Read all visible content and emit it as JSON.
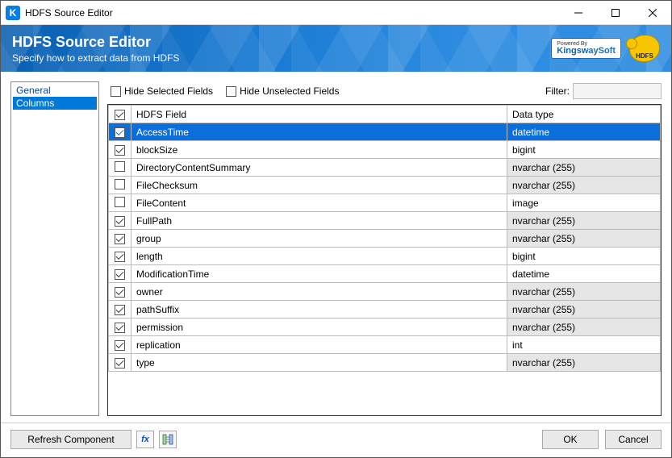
{
  "titlebar": {
    "title": "HDFS Source Editor"
  },
  "banner": {
    "heading": "HDFS Source Editor",
    "subtitle": "Specify how to extract data from HDFS",
    "ksw_powered": "Powered By",
    "ksw_name": "KingswaySoft",
    "hdfs_label": "HDFS"
  },
  "sidebar": {
    "items": [
      {
        "label": "General",
        "selected": false
      },
      {
        "label": "Columns",
        "selected": true
      }
    ]
  },
  "toolbar": {
    "hide_selected": "Hide Selected Fields",
    "hide_unselected": "Hide Unselected Fields",
    "filter_label": "Filter:",
    "filter_value": ""
  },
  "grid": {
    "headers": {
      "field": "HDFS Field",
      "type": "Data type"
    },
    "rows": [
      {
        "checked": true,
        "selected": true,
        "field": "AccessTime",
        "type": "datetime",
        "typeDisabled": false
      },
      {
        "checked": true,
        "selected": false,
        "field": "blockSize",
        "type": "bigint",
        "typeDisabled": false
      },
      {
        "checked": false,
        "selected": false,
        "field": "DirectoryContentSummary",
        "type": "nvarchar (255)",
        "typeDisabled": true
      },
      {
        "checked": false,
        "selected": false,
        "field": "FileChecksum",
        "type": "nvarchar (255)",
        "typeDisabled": true
      },
      {
        "checked": false,
        "selected": false,
        "field": "FileContent",
        "type": "image",
        "typeDisabled": false
      },
      {
        "checked": true,
        "selected": false,
        "field": "FullPath",
        "type": "nvarchar (255)",
        "typeDisabled": true
      },
      {
        "checked": true,
        "selected": false,
        "field": "group",
        "type": "nvarchar (255)",
        "typeDisabled": true
      },
      {
        "checked": true,
        "selected": false,
        "field": "length",
        "type": "bigint",
        "typeDisabled": false
      },
      {
        "checked": true,
        "selected": false,
        "field": "ModificationTime",
        "type": "datetime",
        "typeDisabled": false
      },
      {
        "checked": true,
        "selected": false,
        "field": "owner",
        "type": "nvarchar (255)",
        "typeDisabled": true
      },
      {
        "checked": true,
        "selected": false,
        "field": "pathSuffix",
        "type": "nvarchar (255)",
        "typeDisabled": true
      },
      {
        "checked": true,
        "selected": false,
        "field": "permission",
        "type": "nvarchar (255)",
        "typeDisabled": true
      },
      {
        "checked": true,
        "selected": false,
        "field": "replication",
        "type": "int",
        "typeDisabled": false
      },
      {
        "checked": true,
        "selected": false,
        "field": "type",
        "type": "nvarchar (255)",
        "typeDisabled": true
      }
    ]
  },
  "footer": {
    "refresh": "Refresh Component",
    "fx": "fx",
    "ok": "OK",
    "cancel": "Cancel"
  }
}
